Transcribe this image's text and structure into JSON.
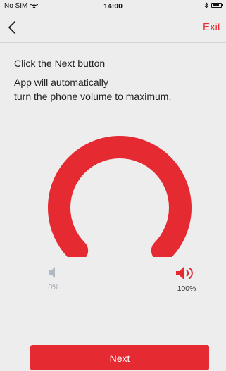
{
  "status_bar": {
    "carrier": "No SIM",
    "time": "14:00",
    "wifi_icon": "wifi-icon",
    "bluetooth_icon": "bluetooth-icon",
    "battery_icon": "battery-icon"
  },
  "nav": {
    "back_icon": "chevron-left-icon",
    "exit_label": "Exit",
    "exit_color": "#e62a32"
  },
  "instructions": {
    "line1": "Click the Next button",
    "line2": "App will automatically",
    "line3": "turn the phone volume to maximum."
  },
  "gauge": {
    "level": 1.0,
    "fill_color": "#e62a32"
  },
  "volume": {
    "min_label": "0%",
    "max_label": "100%",
    "min_icon": "speaker-muted-icon",
    "max_icon": "speaker-loud-icon",
    "min_color": "#b0b8c2",
    "max_color": "#e62a32"
  },
  "next_button": {
    "label": "Next",
    "color": "#e62a32"
  }
}
